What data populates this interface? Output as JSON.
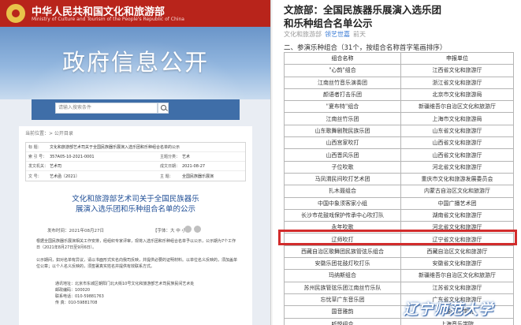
{
  "left": {
    "site_title": "中华人民共和国文化和旅游部",
    "site_sub": "Ministry of Culture and Tourism of the People's Republic of China",
    "hero_title": "政府信息公开",
    "search_placeholder": "请输入搜索条件",
    "breadcrumb": "当前位置：> 公开目录",
    "meta": [
      {
        "k1": "标    题：",
        "v1": "文化和旅游部艺术司关于全国民族器乐展演入选乐团和乐种组合名单的公示",
        "k2": "",
        "v2": ""
      },
      {
        "k1": "索  引  号：",
        "v1": "357A05-10-2021-0001",
        "k2": "主题分类：",
        "v2": "艺术"
      },
      {
        "k1": "发文机关：",
        "v1": "艺术司",
        "k2": "成文日期：",
        "v2": "2021-08-27"
      },
      {
        "k1": "文    号：",
        "v1": "艺术函〔2021〕",
        "k2": "主    题：",
        "v2": "全国民族器乐展演"
      }
    ],
    "doc_title_line1": "文化和旅游部艺术司关于全国民族器乐",
    "doc_title_line2": "展演入选乐团和乐种组合名单的公示",
    "dateline": "发布时间：2021年08月27日",
    "font_label": "【字体：大 中 小】",
    "paragraphs": [
      "根据全国民族器乐展演相关工作安排，经组织专家评审，现将入选乐团和乐种组合名单予以公示，公示期为7个工作日（2021年8月27日至9月6日）。",
      "公示期间，如对名单有异议，请以书面形式实名向我司反映，并提供必要的证明材料。以单位名义反映的，须加盖单位公章；以个人名义反映的，须签署真实姓名并提供有效联系方式。",
      "联系电话：010-59881763"
    ],
    "attachments": [
      "通讯地址：北京市东城区朝阳门北大街10号文化和旅游部艺术司民族民间艺术处",
      "邮政编码：100020",
      "联系电话：010-59881763",
      "传    真：010-59881708"
    ]
  },
  "right": {
    "title_line1": "文旅部：全国民族器乐展演入选乐团",
    "title_line2": "和乐种组合名单公示",
    "source": "文化和旅游部",
    "brand": "领艺世嘉",
    "time": "前天",
    "section": "二、参演乐种组合（31个，按组合名称首字笔画排序）",
    "table_headers": [
      "组合名称",
      "申报单位"
    ],
    "rows": [
      [
        "\"心韵\"组合",
        "江西省文化和旅游厅"
      ],
      [
        "江南丝竹音乐演奏团",
        "浙江省文化和旅游厅"
      ],
      [
        "颜语者打击乐团",
        "北京市文化和旅游局"
      ],
      [
        "\"夏布特\"组合",
        "新疆维吾尔自治区文化和旅游厅"
      ],
      [
        "江南丝竹乐团",
        "上海市文化和旅游局"
      ],
      [
        "山东歌舞剧院民族乐团",
        "山东省文化和旅游厅"
      ],
      [
        "山西宫家吹打",
        "山西省文化和旅游厅"
      ],
      [
        "山西晋风乐团",
        "山西省文化和旅游厅"
      ],
      [
        "子位吹歌",
        "河北省文化和旅游厅"
      ],
      [
        "马凤渭民间吹打艺术团",
        "重庆市文化和旅游发展委员会"
      ],
      [
        "扎木聂组合",
        "内蒙古自治区文化和旅游厅"
      ],
      [
        "中国中象须客家小组",
        "中国广播艺术团"
      ],
      [
        "长沙市花鼓戏保护传承中心吹打队",
        "湖南省文化和旅游厅"
      ],
      [
        "永年吹歌",
        "河北省文化和旅游厅"
      ],
      [
        "辽师吹打",
        "辽宁省文化和旅游厅"
      ],
      [
        "西藏自治区歌舞团民族管弦乐组合",
        "西藏自治区文化和旅游厅"
      ],
      [
        "安徽乐团花鼓灯吹打乐",
        "安徽省文化和旅游厅"
      ],
      [
        "玛纳斯组合",
        "新疆维吾尔自治区文化和旅游厅"
      ],
      [
        "苏州民族管弦乐团江南丝竹乐队",
        "江苏省文化和旅游厅"
      ],
      [
        "忘忧草广东音乐团",
        "广东省文化和旅游厅"
      ],
      [
        "国音雅韵",
        "中国音乐学院"
      ],
      [
        "听悦组合",
        "上海音乐学院"
      ]
    ],
    "watermark": "辽宁师范大学"
  },
  "colors": {
    "brand_red": "#b8241b",
    "link_blue": "#3a7bd5",
    "highlight": "#d22c2c"
  }
}
